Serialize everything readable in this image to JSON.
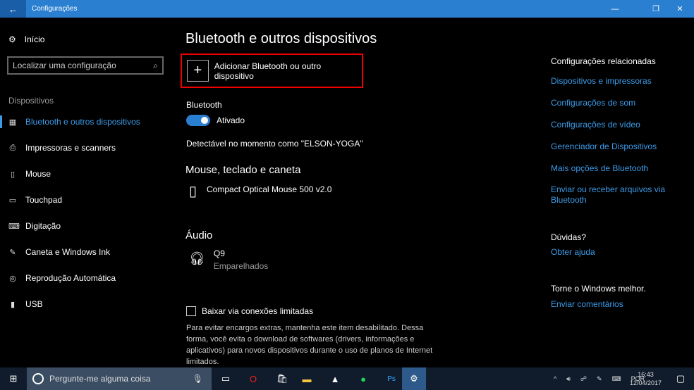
{
  "window": {
    "title": "Configurações",
    "back": "←",
    "minimize": "—",
    "maximize": "❐",
    "close": "✕"
  },
  "sidebar": {
    "home": "Início",
    "search_placeholder": "Localizar uma configuração",
    "section": "Dispositivos",
    "items": [
      {
        "label": "Bluetooth e outros dispositivos",
        "icon": "▦"
      },
      {
        "label": "Impressoras e scanners",
        "icon": "⎙"
      },
      {
        "label": "Mouse",
        "icon": "▯"
      },
      {
        "label": "Touchpad",
        "icon": "▭"
      },
      {
        "label": "Digitação",
        "icon": "⌨"
      },
      {
        "label": "Caneta e Windows Ink",
        "icon": "✎"
      },
      {
        "label": "Reprodução Automática",
        "icon": "◎"
      },
      {
        "label": "USB",
        "icon": "▮"
      }
    ]
  },
  "main": {
    "title": "Bluetooth e outros dispositivos",
    "add_label": "Adicionar Bluetooth ou outro dispositivo",
    "bluetooth_label": "Bluetooth",
    "toggle_state": "Ativado",
    "discoverable": "Detectável no momento como \"ELSON-YOGA\"",
    "mouse_section": "Mouse, teclado e caneta",
    "mouse_device": "Compact Optical Mouse 500 v2.0",
    "audio_section": "Áudio",
    "audio_device": "Q9",
    "audio_status": "Emparelhados",
    "metered_label": "Baixar via conexões limitadas",
    "metered_desc": "Para evitar encargos extras, mantenha este item desabilitado. Dessa forma, você evita o download de softwares (drivers, informações e aplicativos) para novos dispositivos durante o uso de planos de Internet limitados."
  },
  "related": {
    "title": "Configurações relacionadas",
    "links": [
      "Dispositivos e impressoras",
      "Configurações de som",
      "Configurações de vídeo",
      "Gerenciador de Dispositivos",
      "Mais opções de Bluetooth",
      "Enviar ou receber arquivos via Bluetooth"
    ],
    "questions_title": "Dúvidas?",
    "help": "Obter ajuda",
    "improve_title": "Torne o Windows melhor.",
    "feedback": "Enviar comentários"
  },
  "taskbar": {
    "search": "Pergunte-me alguma coisa",
    "lang": "POR",
    "time": "16:43",
    "date": "12/04/2017"
  }
}
